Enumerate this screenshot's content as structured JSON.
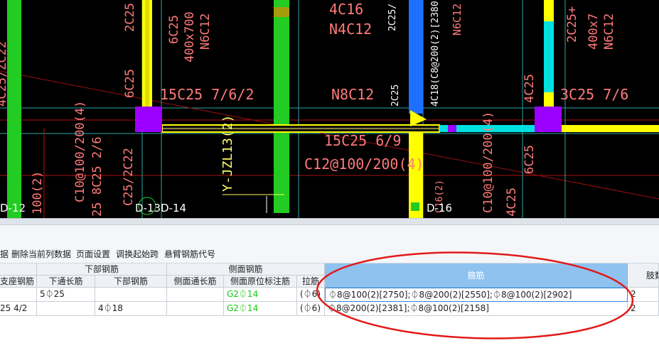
{
  "drawing": {
    "annotations": [
      "2C25",
      "6C25",
      "400x700",
      "N6C12",
      "4C16",
      "N4C12",
      "2C25/",
      "4C18(C8@200(2)[2380])",
      "N6C12",
      "2C25+",
      "400x7",
      "N6C12",
      "6C25",
      "15C25 7/6/2",
      "N8C12",
      "2C25",
      "4C25",
      "3C25 7/6",
      "15C25 6/9",
      "C12@100/200(4)",
      "Y-JZL13(2)",
      "C10@100/200(4)",
      "6C25",
      "4C25",
      "C10@100/200(4)",
      "25 8C25 2/6",
      "C25/2C22",
      "100(2)",
      "4C25/ZC22",
      "C16(2)"
    ],
    "axis_labels": [
      "D-12",
      "D-13",
      "D-14",
      "D-16"
    ]
  },
  "toolbar": {
    "items": [
      "据",
      "删除当前列数据",
      "页面设置",
      "调换起始跨",
      "悬臂钢筋代号"
    ]
  },
  "table": {
    "group_headers": {
      "bottom": "下部钢筋",
      "side": "侧面钢筋",
      "stirrup": "箍筋",
      "legs": "肢数"
    },
    "sub_headers": {
      "support": "支座钢筋",
      "bottom_through": "下通长筋",
      "bottom_bar": "下部钢筋",
      "side_through": "侧面通长筋",
      "side_in_situ": "侧面原位标注筋",
      "tie": "拉筋"
    },
    "rows": [
      {
        "support": "",
        "bottom_through": "5⏀25",
        "bottom_bar": "",
        "side_through": "",
        "side_in_situ": "G2⏀14",
        "tie": "(⏀6)",
        "stirrup": "⏀8@100(2)[2750];⏀8@200(2)[2550];⏀8@100(2)[2902]",
        "legs": "2"
      },
      {
        "support": "25 4/2",
        "bottom_through": "",
        "bottom_bar": "4⏀18",
        "side_through": "",
        "side_in_situ": "G2⏀14",
        "tie": "(⏀6)",
        "stirrup": "⏀8@200(2)[2381];⏀8@100(2)[2158]",
        "legs": "2"
      }
    ]
  },
  "colors": {
    "cad_background": "#000000",
    "column_green": "#22cc22",
    "beam_yellow": "#ffff00",
    "beam_blue": "#1e6fff",
    "beam_cyan": "#00e0e0",
    "support_purple": "#9b00ff",
    "highlight_red": "#e21a1a",
    "header_selected": "#8fc2ef",
    "green_text": "#14c814"
  }
}
